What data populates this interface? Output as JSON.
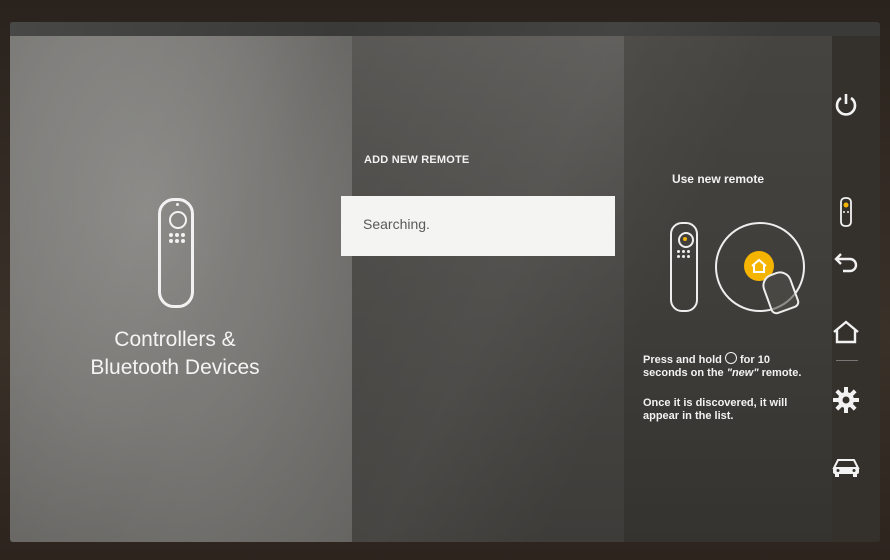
{
  "left_panel": {
    "icon": "remote-control-icon",
    "title_line1": "Controllers &",
    "title_line2": "Bluetooth Devices"
  },
  "middle_panel": {
    "heading": "ADD NEW REMOTE",
    "search_status": "Searching."
  },
  "right_panel": {
    "title": "Use new remote",
    "instruction_line1": "Press and hold",
    "instruction_icon": "home-button-icon",
    "instruction_line2": "for 10",
    "instruction_line3": "seconds on the",
    "instruction_emphasis": "\"new\"",
    "instruction_line4": "remote.",
    "discover_line1": "Once it is discovered, it will",
    "discover_line2": "appear in the list."
  },
  "nav": {
    "items": [
      {
        "name": "power",
        "icon": "power-icon"
      },
      {
        "name": "remote",
        "icon": "remote-icon"
      },
      {
        "name": "back",
        "icon": "back-arrow-icon"
      },
      {
        "name": "home",
        "icon": "home-icon"
      },
      {
        "name": "settings",
        "icon": "gear-icon"
      },
      {
        "name": "car",
        "icon": "car-icon"
      }
    ]
  },
  "colors": {
    "accent": "#f5b400",
    "text": "#f2f2f2",
    "selected_row": "#f4f4f2"
  }
}
